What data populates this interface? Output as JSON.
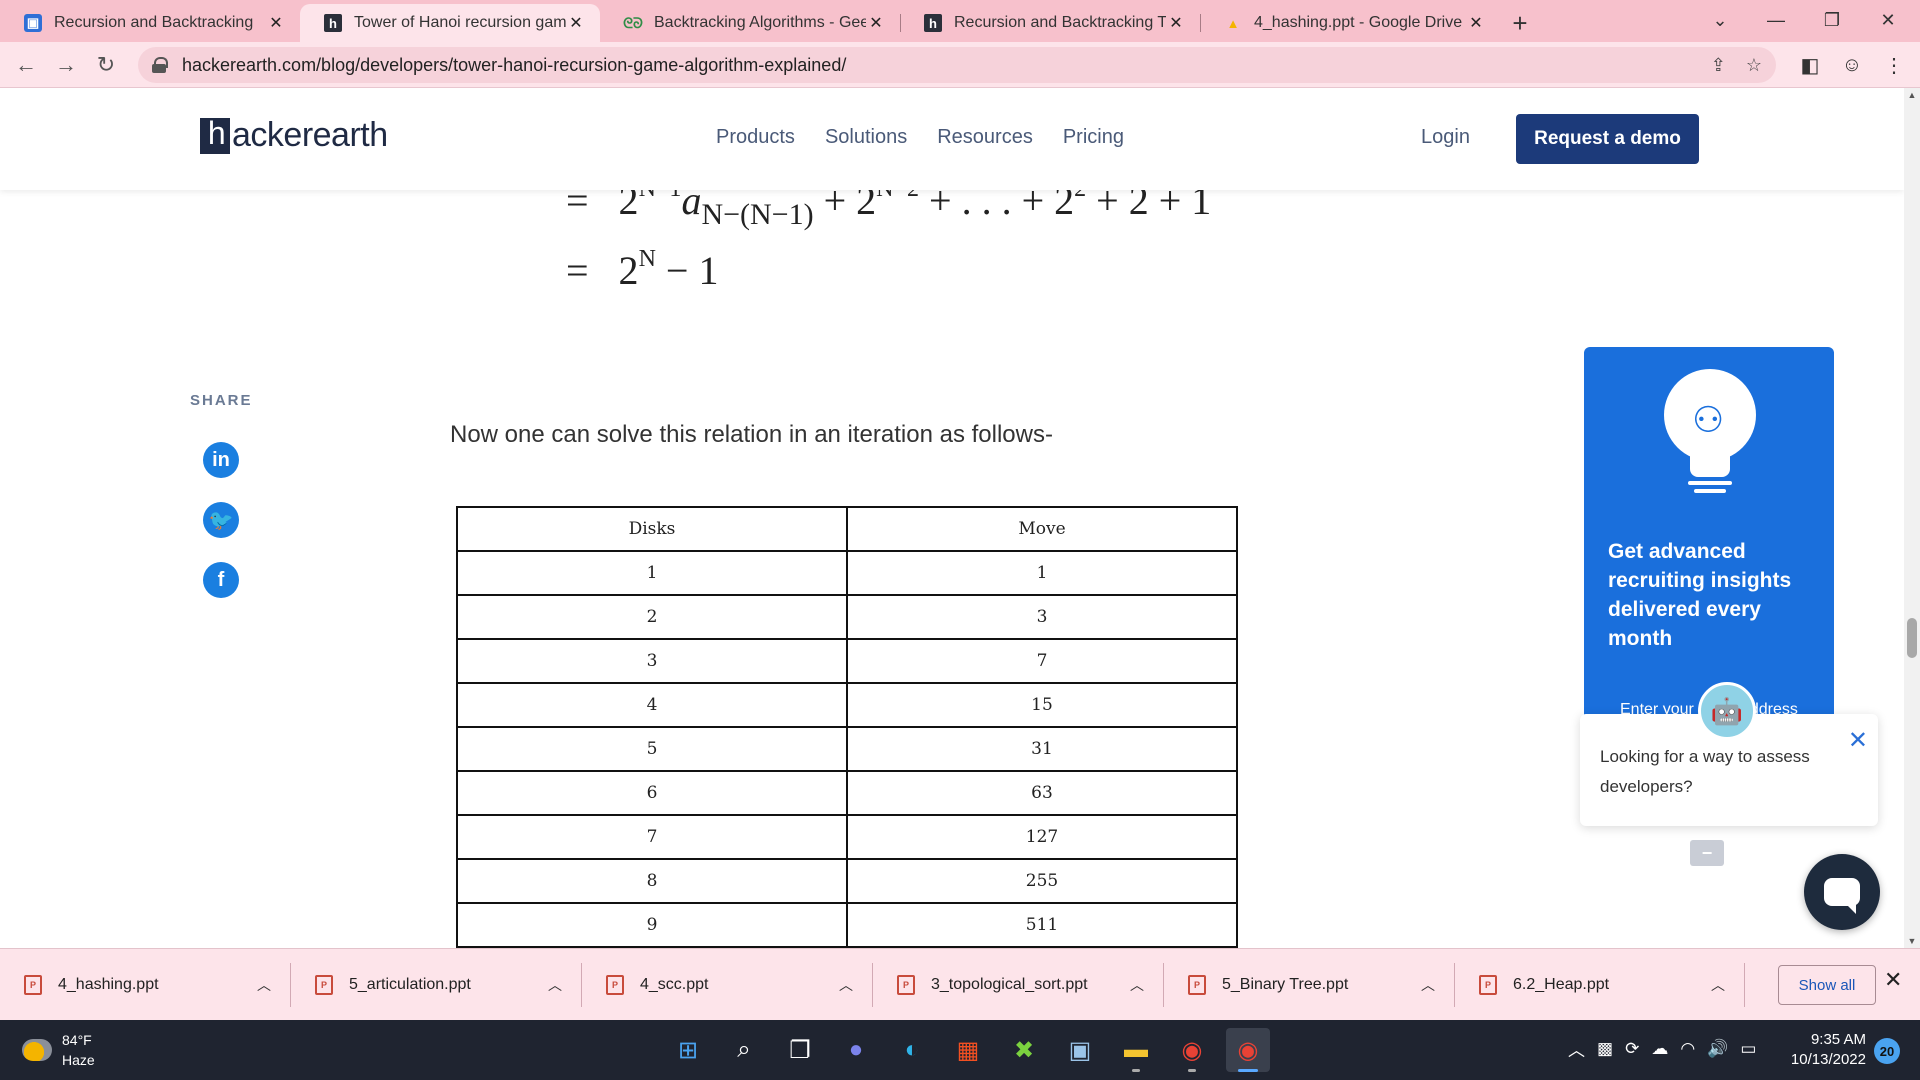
{
  "browser": {
    "tabs": [
      {
        "title": "Recursion and Backtracking",
        "favicon": "classroom-icon",
        "active": false
      },
      {
        "title": "Tower of Hanoi recursion game a",
        "favicon": "hackerearth-icon",
        "active": true
      },
      {
        "title": "Backtracking Algorithms - Geeks",
        "favicon": "gfg-icon",
        "active": false
      },
      {
        "title": "Recursion and Backtracking Tuto",
        "favicon": "hackerearth-icon",
        "active": false
      },
      {
        "title": "4_hashing.ppt - Google Drive",
        "favicon": "drive-icon",
        "active": false
      }
    ],
    "url": "hackerearth.com/blog/developers/tower-hanoi-recursion-game-algorithm-explained/"
  },
  "site": {
    "logo_rest": "ackerearth",
    "logo_h": "h",
    "nav": [
      "Products",
      "Solutions",
      "Resources",
      "Pricing"
    ],
    "login": "Login",
    "demo": "Request a demo"
  },
  "article": {
    "share_label": "SHARE",
    "lead": "Now one can solve this relation in an iteration as follows-",
    "table": {
      "headers": [
        "Disks",
        "Move"
      ],
      "rows": [
        [
          "1",
          "1"
        ],
        [
          "2",
          "3"
        ],
        [
          "3",
          "7"
        ],
        [
          "4",
          "15"
        ],
        [
          "5",
          "31"
        ],
        [
          "6",
          "63"
        ],
        [
          "7",
          "127"
        ],
        [
          "8",
          "255"
        ],
        [
          "9",
          "511"
        ]
      ]
    }
  },
  "promo": {
    "text": "Get advanced recruiting insights delivered every month",
    "email_placeholder": "Enter your email address"
  },
  "chat": {
    "message": "Looking for a way to assess developers?"
  },
  "downloads": {
    "items": [
      "4_hashing.ppt",
      "5_articulation.ppt",
      "4_scc.ppt",
      "3_topological_sort.ppt",
      "5_Binary Tree.ppt",
      "6.2_Heap.ppt"
    ],
    "show_all": "Show all"
  },
  "taskbar": {
    "temperature": "84°F",
    "weather": "Haze",
    "time": "9:35 AM",
    "date": "10/13/2022",
    "notifications": "20"
  },
  "colors": {
    "chrome_tabstrip": "#f7c1cc",
    "chrome_toolbar": "#fde4ea",
    "brand_navy": "#1c3a7a",
    "promo_blue": "#1a6fdc"
  }
}
